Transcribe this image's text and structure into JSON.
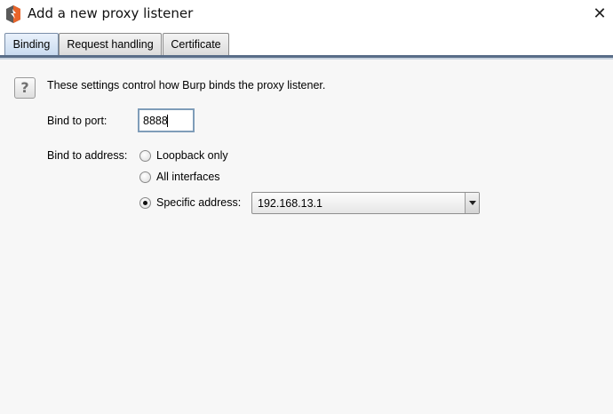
{
  "window": {
    "title": "Add a new proxy listener",
    "close_symbol": "✕"
  },
  "tabs": [
    {
      "label": "Binding",
      "active": true
    },
    {
      "label": "Request handling",
      "active": false
    },
    {
      "label": "Certificate",
      "active": false
    }
  ],
  "binding": {
    "help_symbol": "?",
    "description": "These settings control how Burp binds the proxy listener.",
    "port_label": "Bind to port:",
    "port_value": "8888",
    "address_label": "Bind to address:",
    "options": [
      {
        "label": "Loopback only",
        "selected": false
      },
      {
        "label": "All interfaces",
        "selected": false
      },
      {
        "label": "Specific address:",
        "selected": true
      }
    ],
    "specific_address_value": "192.168.13.1"
  },
  "colors": {
    "accent": "#e8642a",
    "tab_underline": "#596d88",
    "input_border": "#7f9db9"
  },
  "icons": {
    "app": "burp-suite-icon",
    "close": "close-icon",
    "help": "help-icon",
    "dropdown": "chevron-down-icon"
  }
}
